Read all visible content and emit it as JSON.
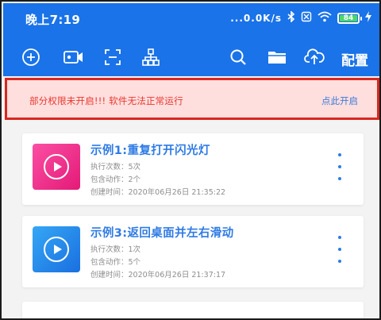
{
  "status_bar": {
    "time": "晚上7:19",
    "network_speed": "...0.0K/s",
    "battery_level": "84"
  },
  "toolbar": {
    "icons": [
      "add-circle-icon",
      "video-camera-icon",
      "scan-frame-icon",
      "hierarchy-icon"
    ],
    "right_icons": [
      "search-icon",
      "folder-icon",
      "cloud-upload-icon"
    ],
    "config_label": "配置"
  },
  "warning": {
    "message": "部分权限未开启!!! 软件无法正常运行",
    "action": "点此开启"
  },
  "cards": [
    {
      "title": "示例1:重复打开闪光灯",
      "run_count": "执行次数：5次",
      "action_count": "包含动作：2个",
      "created": "创建时间：2020年06月26日 21:35:22",
      "thumb_color": "#ee2d8a"
    },
    {
      "title": "示例3:返回桌面并左右滑动",
      "run_count": "执行次数：1次",
      "action_count": "包含动作：5个",
      "created": "创建时间：2020年06月26日 21:37:17",
      "thumb_color": "#238ae8"
    }
  ],
  "colors": {
    "primary": "#1a73e8",
    "warning_bg": "#ffdede",
    "warning_border": "#d7271f",
    "warning_text": "#e8392e",
    "link": "#3d7bd6"
  }
}
